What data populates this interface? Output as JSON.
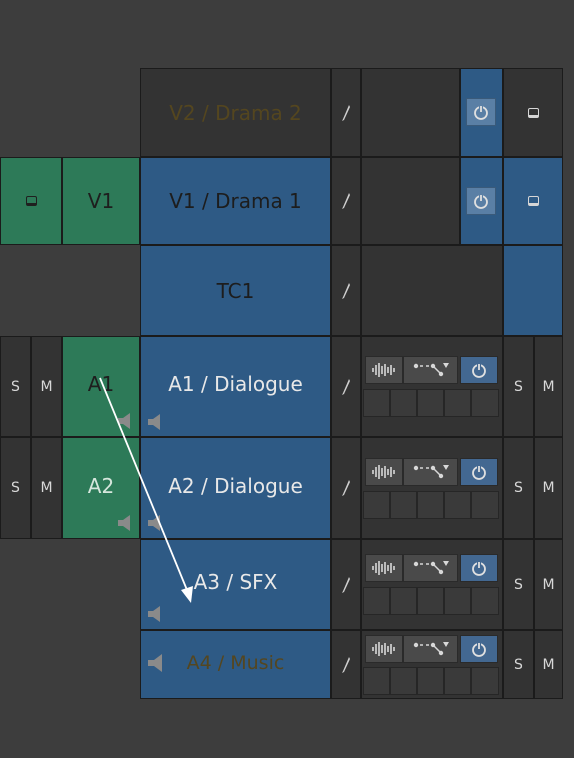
{
  "tracks": {
    "v2": {
      "name": "V2 / Drama 2"
    },
    "v1": {
      "name": "V1 / Drama 1",
      "source": "V1"
    },
    "tc1": {
      "name": "TC1"
    },
    "a1": {
      "name": "A1 / Dialogue",
      "source": "A1",
      "solo": "S",
      "mute": "M"
    },
    "a2": {
      "name": "A2 / Dialogue",
      "source": "A2",
      "solo": "S",
      "mute": "M"
    },
    "a3": {
      "name": "A3 / SFX",
      "solo": "S",
      "mute": "M"
    },
    "a4": {
      "name": "A4 / Music",
      "solo": "S",
      "mute": "M"
    }
  },
  "colors": {
    "background": "#3d3d3d",
    "track_blue": "#2e5a85",
    "source_green": "#2d7a58",
    "cell_dark": "#333333",
    "button_active": "#436891"
  },
  "icons": {
    "patch_arrow": "arrow-icon",
    "speaker": "speaker-icon",
    "pen": "pen-icon",
    "waveform": "waveform-icon",
    "keyframe": "keyframe-icon",
    "power": "power-icon",
    "toggle": "square-toggle-icon"
  }
}
